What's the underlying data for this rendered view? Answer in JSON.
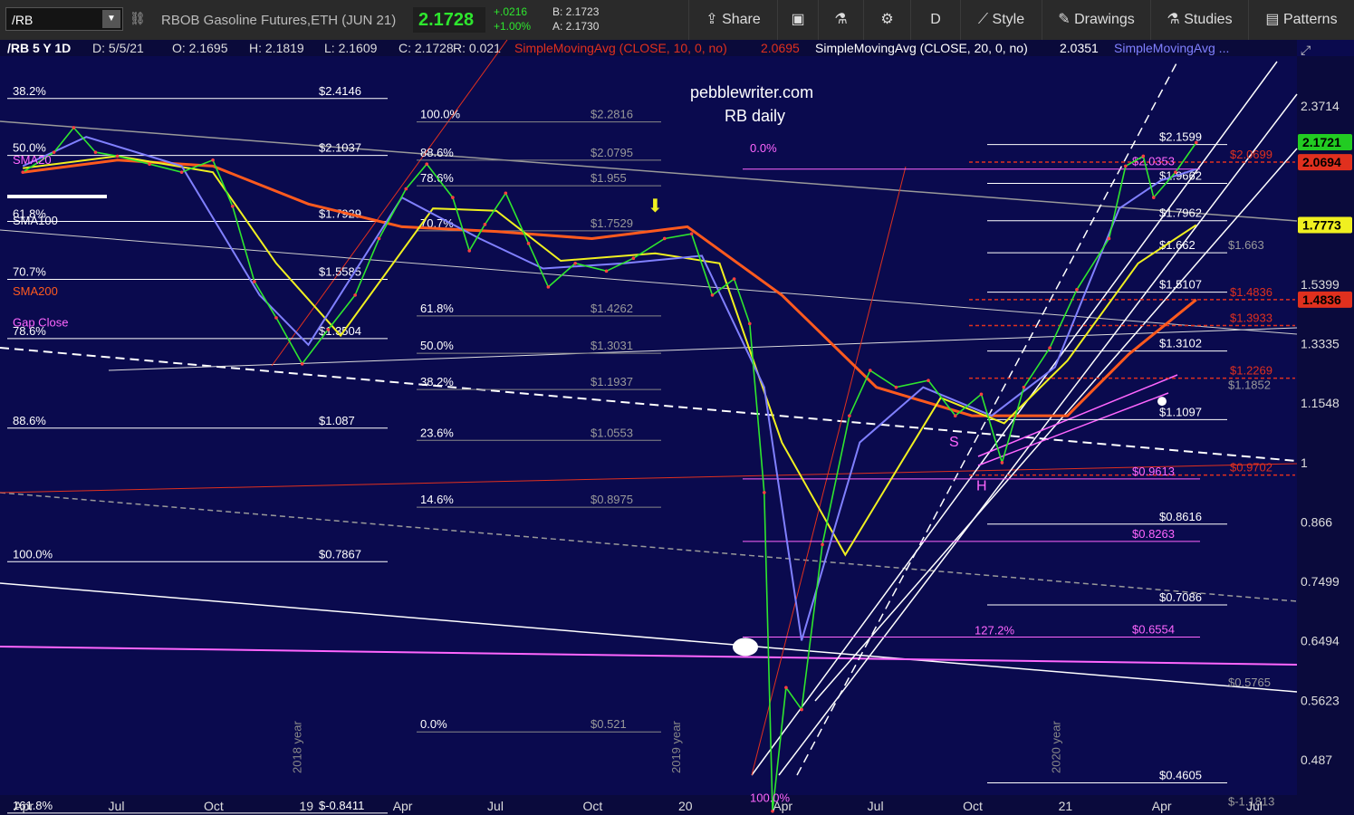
{
  "toolbar": {
    "symbol": "/RB",
    "description": "RBOB Gasoline Futures,ETH (JUN 21)",
    "last": "2.1728",
    "change": "+.0216",
    "change_pct": "+1.00%",
    "bid": "B: 2.1723",
    "ask": "A: 2.1730",
    "share": "Share",
    "interval": "D",
    "style": "Style",
    "drawings": "Drawings",
    "studies": "Studies",
    "patterns": "Patterns"
  },
  "chart_data": {
    "type": "line",
    "header": {
      "symbol": "/RB 5 Y 1D",
      "date": "D: 5/5/21",
      "open": "O: 2.1695",
      "high": "H: 2.1819",
      "low": "L: 2.1609",
      "close": "C: 2.1728",
      "range": "R: 0.021",
      "study1": "SimpleMovingAvg (CLOSE, 10, 0, no)",
      "study1_value": "2.0695",
      "study2": "SimpleMovingAvg (CLOSE, 20, 0, no)",
      "study2_value": "2.0351",
      "study3": "SimpleMovingAvg ..."
    },
    "watermark": [
      "pebblewriter.com",
      "RB daily"
    ],
    "y_scale": "log",
    "ylim": [
      0.42,
      2.6
    ],
    "x_ticks": [
      "Apr",
      "Jul",
      "Oct",
      "19",
      "Apr",
      "Jul",
      "Oct",
      "20",
      "Apr",
      "Jul",
      "Oct",
      "21",
      "Apr",
      "Jul"
    ],
    "y_ticks": [
      "2.3714",
      "1.5399",
      "1.3335",
      "1.1548",
      "1",
      "0.866",
      "0.7499",
      "0.6494",
      "0.5623",
      "0.487"
    ],
    "year_labels": [
      "2018 year",
      "2019 year",
      "2020 year"
    ],
    "price_badges": [
      {
        "label": "2.1721",
        "value": 2.1721,
        "color": "#22cc22"
      },
      {
        "label": "2.0694",
        "value": 2.0694,
        "color": "#e0301e"
      },
      {
        "label": "1.7773",
        "value": 1.7773,
        "color": "#f0f020"
      },
      {
        "label": "1.4836",
        "value": 1.4836,
        "color": "#e0301e"
      }
    ],
    "price_points": [
      [
        "2018-04-01",
        2.02
      ],
      [
        "2018-05-01",
        2.12
      ],
      [
        "2018-05-20",
        2.25
      ],
      [
        "2018-06-10",
        2.12
      ],
      [
        "2018-07-01",
        2.1
      ],
      [
        "2018-08-01",
        2.06
      ],
      [
        "2018-09-01",
        2.02
      ],
      [
        "2018-10-01",
        2.08
      ],
      [
        "2018-10-20",
        1.86
      ],
      [
        "2018-11-10",
        1.55
      ],
      [
        "2018-12-01",
        1.42
      ],
      [
        "2018-12-26",
        1.27
      ],
      [
        "2019-01-20",
        1.38
      ],
      [
        "2019-02-15",
        1.5
      ],
      [
        "2019-03-10",
        1.72
      ],
      [
        "2019-04-05",
        1.94
      ],
      [
        "2019-04-25",
        2.06
      ],
      [
        "2019-05-20",
        1.9
      ],
      [
        "2019-06-05",
        1.67
      ],
      [
        "2019-06-20",
        1.78
      ],
      [
        "2019-07-10",
        1.92
      ],
      [
        "2019-08-01",
        1.7
      ],
      [
        "2019-08-20",
        1.53
      ],
      [
        "2019-09-15",
        1.62
      ],
      [
        "2019-10-15",
        1.59
      ],
      [
        "2019-11-10",
        1.64
      ],
      [
        "2019-12-10",
        1.72
      ],
      [
        "2020-01-05",
        1.74
      ],
      [
        "2020-01-25",
        1.5
      ],
      [
        "2020-02-15",
        1.56
      ],
      [
        "2020-03-01",
        1.4
      ],
      [
        "2020-03-15",
        0.93
      ],
      [
        "2020-03-23",
        0.43
      ],
      [
        "2020-04-05",
        0.58
      ],
      [
        "2020-04-20",
        0.55
      ],
      [
        "2020-05-10",
        0.82
      ],
      [
        "2020-06-05",
        1.12
      ],
      [
        "2020-06-25",
        1.25
      ],
      [
        "2020-07-20",
        1.2
      ],
      [
        "2020-08-20",
        1.22
      ],
      [
        "2020-09-15",
        1.12
      ],
      [
        "2020-10-10",
        1.18
      ],
      [
        "2020-10-30",
        1.0
      ],
      [
        "2020-11-20",
        1.2
      ],
      [
        "2020-12-15",
        1.32
      ],
      [
        "2021-01-10",
        1.52
      ],
      [
        "2021-02-10",
        1.72
      ],
      [
        "2021-02-26",
        2.05
      ],
      [
        "2021-03-15",
        2.1
      ],
      [
        "2021-03-25",
        1.9
      ],
      [
        "2021-04-15",
        2.02
      ],
      [
        "2021-05-05",
        2.17
      ]
    ],
    "sma200_points": [
      [
        "2018-04-01",
        2.02
      ],
      [
        "2018-07-01",
        2.08
      ],
      [
        "2018-10-01",
        2.05
      ],
      [
        "2019-01-01",
        1.87
      ],
      [
        "2019-04-01",
        1.77
      ],
      [
        "2019-07-01",
        1.75
      ],
      [
        "2019-10-01",
        1.72
      ],
      [
        "2020-01-01",
        1.77
      ],
      [
        "2020-04-01",
        1.5
      ],
      [
        "2020-07-01",
        1.2
      ],
      [
        "2020-10-01",
        1.12
      ],
      [
        "2021-01-01",
        1.12
      ],
      [
        "2021-03-01",
        1.3
      ],
      [
        "2021-05-05",
        1.4836
      ]
    ],
    "sma50_points": [
      [
        "2018-04-01",
        2.04
      ],
      [
        "2018-07-01",
        2.1
      ],
      [
        "2018-10-01",
        2.02
      ],
      [
        "2018-12-01",
        1.62
      ],
      [
        "2019-02-01",
        1.36
      ],
      [
        "2019-05-01",
        1.85
      ],
      [
        "2019-07-01",
        1.84
      ],
      [
        "2019-09-01",
        1.63
      ],
      [
        "2019-12-01",
        1.66
      ],
      [
        "2020-02-01",
        1.62
      ],
      [
        "2020-04-01",
        1.05
      ],
      [
        "2020-06-01",
        0.8
      ],
      [
        "2020-07-20",
        0.98
      ],
      [
        "2020-09-01",
        1.17
      ],
      [
        "2020-11-01",
        1.1
      ],
      [
        "2021-01-01",
        1.28
      ],
      [
        "2021-03-10",
        1.62
      ],
      [
        "2021-05-05",
        1.7773
      ]
    ],
    "sma20_points": [
      [
        "2018-04-01",
        2.05
      ],
      [
        "2018-06-01",
        2.2
      ],
      [
        "2018-09-01",
        2.05
      ],
      [
        "2018-11-15",
        1.5
      ],
      [
        "2019-01-01",
        1.33
      ],
      [
        "2019-04-01",
        1.9
      ],
      [
        "2019-06-15",
        1.72
      ],
      [
        "2019-08-15",
        1.6
      ],
      [
        "2019-11-01",
        1.62
      ],
      [
        "2020-01-15",
        1.65
      ],
      [
        "2020-03-15",
        1.2
      ],
      [
        "2020-04-20",
        0.65
      ],
      [
        "2020-06-15",
        1.05
      ],
      [
        "2020-08-15",
        1.2
      ],
      [
        "2020-10-20",
        1.12
      ],
      [
        "2020-12-20",
        1.26
      ],
      [
        "2021-02-20",
        1.85
      ],
      [
        "2021-04-01",
        1.98
      ],
      [
        "2021-05-05",
        2.0351
      ]
    ],
    "fib_left": [
      {
        "label": "38.2%",
        "value_label": "$2.4146",
        "value": 2.4146
      },
      {
        "label": "50.0%",
        "value_label": "$2.1037",
        "value": 2.1037
      },
      {
        "label": "61.8%",
        "value_label": "$1.7929",
        "value": 1.7929
      },
      {
        "label": "70.7%",
        "value_label": "$1.5585",
        "value": 1.5585
      },
      {
        "label": "78.6%",
        "value_label": "$1.3504",
        "value": 1.3504
      },
      {
        "label": "88.6%",
        "value_label": "$1.087",
        "value": 1.087
      },
      {
        "label": "100.0%",
        "value_label": "$0.7867",
        "value": 0.7867
      },
      {
        "label": "161.8%",
        "value_label": "$-0.8411",
        "value": 0.428
      }
    ],
    "fib_mid_labels": [
      "100.0%",
      "88.6%",
      "78.6%",
      "70.7%",
      "61.8%",
      "50.0%",
      "38.2%",
      "23.6%",
      "14.6%",
      "0.0%"
    ],
    "fib_mid_values": [
      2.2816,
      2.0795,
      1.955,
      1.7529,
      1.4262,
      1.3031,
      1.1937,
      1.0553,
      0.8975,
      0.521
    ],
    "fib_mid_value_labels": [
      "$2.2816",
      "$2.0795",
      "$1.955",
      "$1.7529",
      "$1.4262",
      "$1.3031",
      "$1.1937",
      "$1.0553",
      "$0.8975",
      "$0.521"
    ],
    "fib_right": [
      {
        "label": "$2.1599",
        "value": 2.1599
      },
      {
        "label": "$1.9662",
        "value": 1.9662
      },
      {
        "label": "$1.7962",
        "value": 1.7962
      },
      {
        "label": "$1.662",
        "value": 1.662
      },
      {
        "label": "$1.5107",
        "value": 1.5107
      },
      {
        "label": "$1.3102",
        "value": 1.3102
      },
      {
        "label": "$1.1097",
        "value": 1.1097
      },
      {
        "label": "$0.8616",
        "value": 0.8616
      },
      {
        "label": "$0.7086",
        "value": 0.7086
      },
      {
        "label": "$0.4605",
        "value": 0.4605
      }
    ],
    "fib_red": [
      {
        "label": "$2.0699",
        "value": 2.0699
      },
      {
        "label": "$1.4836",
        "value": 1.4836
      },
      {
        "label": "$1.3933",
        "value": 1.3933
      },
      {
        "label": "$1.2269",
        "value": 1.2269
      },
      {
        "label": "$0.9702",
        "value": 0.9702
      }
    ],
    "fib_pink": [
      {
        "label": "$2.0353",
        "value": 2.0353
      },
      {
        "label": "$0.9613",
        "value": 0.9613
      },
      {
        "label": "$0.8263",
        "value": 0.8263
      },
      {
        "label": "$0.6554",
        "value": 0.6554
      }
    ],
    "fib_gray_right": [
      {
        "label": "$1.663",
        "value": 1.663
      },
      {
        "label": "$1.1852",
        "value": 1.1852
      },
      {
        "label": "$0.5765",
        "value": 0.5765
      },
      {
        "label": "$-1.1813",
        "value": 0.432
      }
    ],
    "annotations": [
      "SMA20",
      "SMA100",
      "SMA200",
      "Gap Close",
      "S",
      "H",
      "127.2%",
      "100.0%",
      "0.0%"
    ]
  }
}
